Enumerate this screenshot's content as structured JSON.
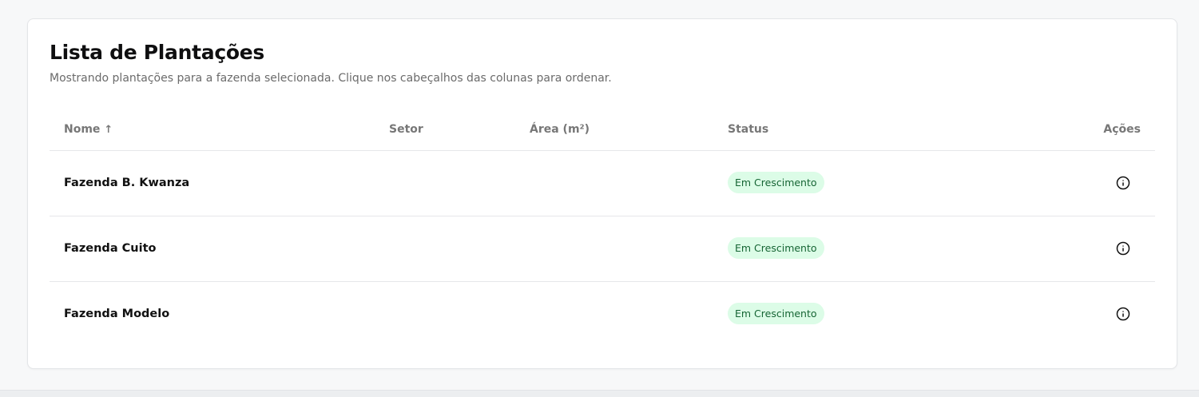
{
  "card": {
    "title": "Lista de Plantações",
    "subtitle": "Mostrando plantações para a fazenda selecionada. Clique nos cabeçalhos das colunas para ordenar."
  },
  "table": {
    "headers": {
      "nome": "Nome",
      "nome_sort": "↑",
      "setor": "Setor",
      "area": "Área (m²)",
      "status": "Status",
      "acoes": "Ações"
    },
    "rows": [
      {
        "nome": "Fazenda B. Kwanza",
        "setor": "",
        "area": "",
        "status": "Em Crescimento",
        "action_icon": "info-icon"
      },
      {
        "nome": "Fazenda Cuito",
        "setor": "",
        "area": "",
        "status": "Em Crescimento",
        "action_icon": "info-icon"
      },
      {
        "nome": "Fazenda Modelo",
        "setor": "",
        "area": "",
        "status": "Em Crescimento",
        "action_icon": "info-icon"
      }
    ]
  },
  "colors": {
    "status_badge_bg": "#dcfce7",
    "status_badge_text": "#166534",
    "header_text": "#777777"
  }
}
